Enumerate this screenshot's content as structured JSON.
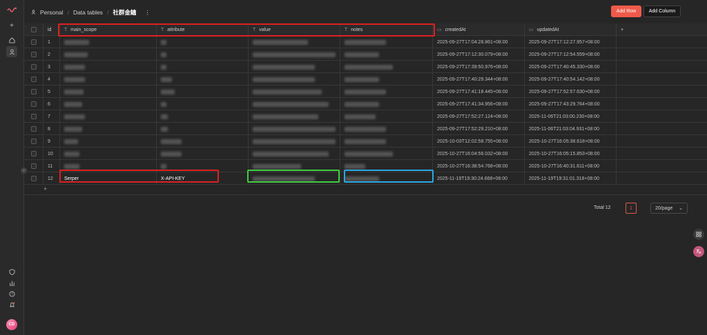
{
  "breadcrumb": {
    "workspace": "Personal",
    "section": "Data tables",
    "table": "社群金鑰",
    "more": "⋮"
  },
  "toolbar": {
    "add_row": "Add Row",
    "add_column": "Add Column"
  },
  "columns": {
    "id": "id",
    "main_scope": "main_scope",
    "attribute": "attribute",
    "value": "value",
    "notes": "notes",
    "created_at": "createdAt",
    "updated_at": "updatedAt",
    "add": "+"
  },
  "rows": [
    {
      "id": "1",
      "createdAt": "2025-09-27T17:04:28.861+08:00",
      "updatedAt": "2025-09-27T17:12:27.957+08:00"
    },
    {
      "id": "2",
      "createdAt": "2025-09-27T17:12:30.079+08:00",
      "updatedAt": "2025-09-27T17:12:54.559+08:00"
    },
    {
      "id": "3",
      "createdAt": "2025-09-27T17:39:50.976+08:00",
      "updatedAt": "2025-09-27T17:40:45.330+08:00"
    },
    {
      "id": "4",
      "createdAt": "2025-09-27T17:40:29.344+08:00",
      "updatedAt": "2025-09-27T17:40:54.142+08:00"
    },
    {
      "id": "5",
      "createdAt": "2025-09-27T17:41:18.445+08:00",
      "updatedAt": "2025-09-27T17:52:57.630+08:00"
    },
    {
      "id": "6",
      "createdAt": "2025-09-27T17:41:34.956+08:00",
      "updatedAt": "2025-09-27T17:43:29.764+08:00"
    },
    {
      "id": "7",
      "createdAt": "2025-09-27T17:52:27.124+08:00",
      "updatedAt": "2025-11-06T21:03:00.230+08:00"
    },
    {
      "id": "8",
      "createdAt": "2025-09-27T17:52:29.210+08:00",
      "updatedAt": "2025-11-06T21:03:04.931+08:00"
    },
    {
      "id": "9",
      "createdAt": "2025-10-03T12:02:58.755+08:00",
      "updatedAt": "2025-10-27T16:05:38.618+08:00"
    },
    {
      "id": "10",
      "createdAt": "2025-10-27T16:04:56.032+08:00",
      "updatedAt": "2025-10-27T16:05:15.853+08:00"
    },
    {
      "id": "11",
      "createdAt": "2025-10-27T16:38:54.768+08:00",
      "updatedAt": "2025-10-27T16:40:31.611+08:00"
    },
    {
      "id": "12",
      "main_scope": "Serper",
      "attribute": "X-API-KEY",
      "createdAt": "2025-11-19T19:30:24.668+08:00",
      "updatedAt": "2025-11-19T19:31:01.318+08:00"
    }
  ],
  "add_row_plus": "+",
  "pagination": {
    "total": "Total 12",
    "page": "1",
    "page_size": "20/page"
  },
  "user": {
    "initials": "CD"
  },
  "colors": {
    "accent": "#f05a4a",
    "highlight_red": "#e02020",
    "highlight_green": "#3ecf3e",
    "highlight_blue": "#2aa8e8"
  }
}
